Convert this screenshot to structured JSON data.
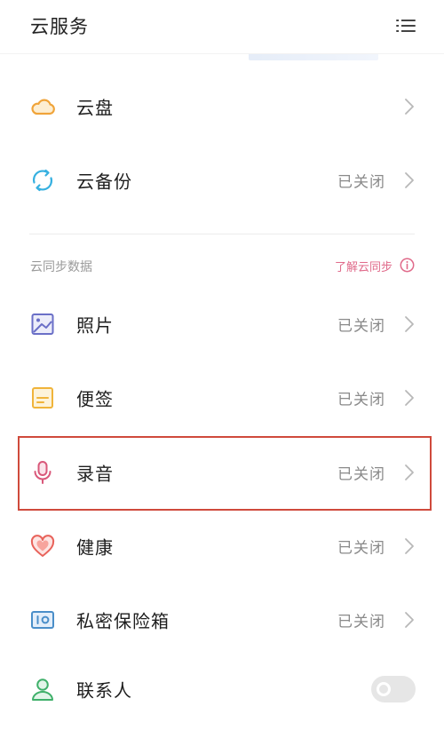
{
  "header": {
    "title": "云服务"
  },
  "cloud": {
    "items": [
      {
        "label": "云盘",
        "status": ""
      },
      {
        "label": "云备份",
        "status": "已关闭"
      }
    ]
  },
  "sync_section": {
    "title": "云同步数据",
    "learn_link": "了解云同步",
    "items": [
      {
        "label": "照片",
        "status": "已关闭"
      },
      {
        "label": "便签",
        "status": "已关闭"
      },
      {
        "label": "录音",
        "status": "已关闭"
      },
      {
        "label": "健康",
        "status": "已关闭"
      },
      {
        "label": "私密保险箱",
        "status": "已关闭"
      },
      {
        "label": "联系人",
        "toggle_on": false
      }
    ]
  },
  "colors": {
    "cloud_disk_icon": "#f0a43a",
    "backup_icon": "#35b0e0",
    "photos_icon": "#6a6fc7",
    "notes_icon": "#f0b43a",
    "recorder_icon": "#d9587a",
    "health_icon": "#e8625a",
    "vault_icon": "#4a8ec9",
    "contacts_icon": "#3fb06a",
    "learn_link": "#e06a8a",
    "highlight_border": "#cf4a3c"
  },
  "icons": {
    "menu": "list-menu-icon",
    "cloud_disk": "cloud-icon",
    "backup": "sync-circle-icon",
    "photos": "photo-icon",
    "notes": "note-icon",
    "recorder": "microphone-icon",
    "health": "heart-icon",
    "vault": "safe-icon",
    "contacts": "person-icon",
    "info": "info-icon",
    "chevron": "chevron-right-icon"
  }
}
